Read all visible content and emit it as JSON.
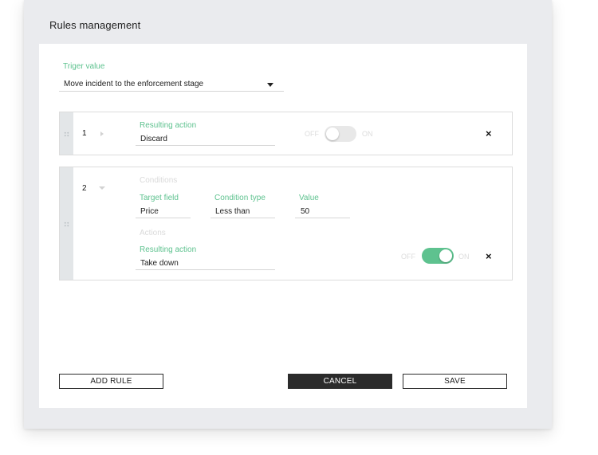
{
  "window": {
    "title": "Rules management"
  },
  "trigger": {
    "label": "Triger value",
    "value": "Move incident to the enforcement stage"
  },
  "rules": [
    {
      "number": "1",
      "resulting_action_label": "Resulting action",
      "resulting_action_value": "Discard",
      "toggle": {
        "off_label": "OFF",
        "on_label": "ON",
        "state": "off"
      }
    },
    {
      "number": "2",
      "conditions_heading": "Conditions",
      "target_field_label": "Target field",
      "target_field_value": "Price",
      "condition_type_label": "Condition type",
      "condition_type_value": "Less than",
      "value_label": "Value",
      "value_value": "50",
      "actions_heading": "Actions",
      "resulting_action_label": "Resulting action",
      "resulting_action_value": "Take down",
      "toggle": {
        "off_label": "OFF",
        "on_label": "ON",
        "state": "on"
      }
    }
  ],
  "close_glyph": "×",
  "buttons": {
    "add_rule": "ADD RULE",
    "cancel": "CANCEL",
    "save": "SAVE"
  },
  "colors": {
    "accent_green": "#5ec28f",
    "dark_button": "#2b2b2b"
  }
}
